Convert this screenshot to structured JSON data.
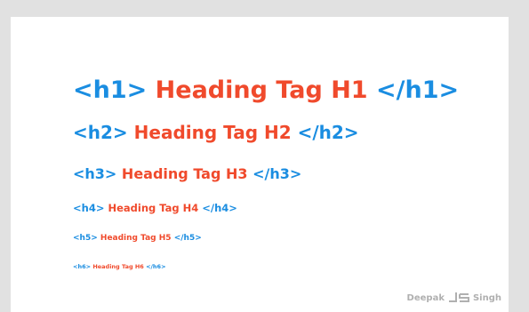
{
  "headings": [
    {
      "level": "h1",
      "open_tag": "<h1>",
      "text": "Heading Tag H1",
      "close_tag": "</h1>"
    },
    {
      "level": "h2",
      "open_tag": "<h2>",
      "text": "Heading Tag H2",
      "close_tag": "</h2>"
    },
    {
      "level": "h3",
      "open_tag": "<h3>",
      "text": "Heading Tag H3",
      "close_tag": "</h3>"
    },
    {
      "level": "h4",
      "open_tag": "<h4>",
      "text": "Heading Tag H4",
      "close_tag": "</h4>"
    },
    {
      "level": "h5",
      "open_tag": "<h5>",
      "text": "Heading Tag H5",
      "close_tag": "</h5>"
    },
    {
      "level": "h6",
      "open_tag": "<h6>",
      "text": "Heading Tag H6",
      "close_tag": "</h6>"
    }
  ],
  "logo": {
    "left_text": "Deepak",
    "mark": "ds",
    "right_text": "Singh"
  },
  "colors": {
    "tag": "#1a8de1",
    "text": "#f04a2c",
    "background": "#e1e1e1",
    "card": "#ffffff"
  }
}
